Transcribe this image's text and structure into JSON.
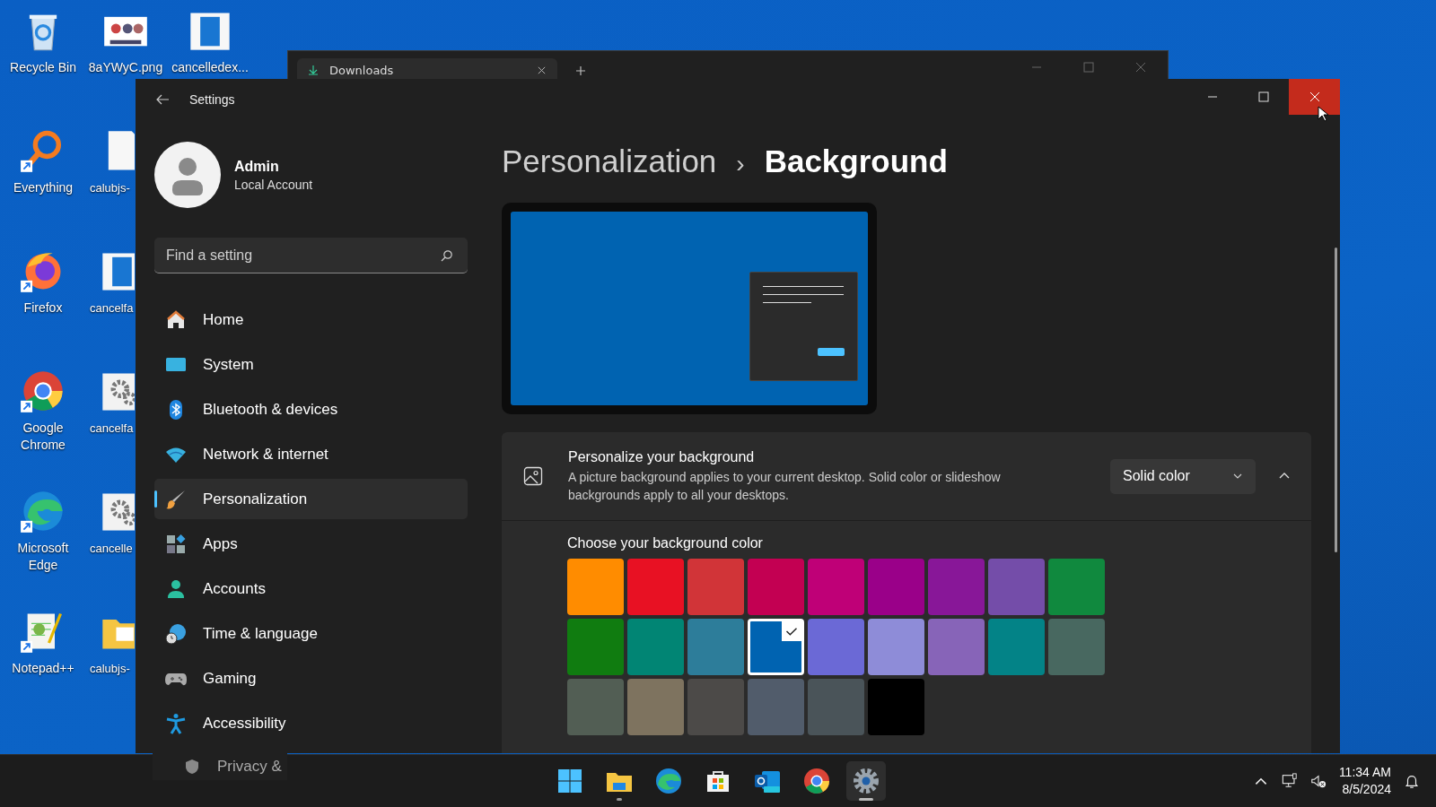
{
  "desktop": {
    "icons": [
      {
        "label": "Recycle Bin",
        "kind": "recycle",
        "shortcut": false
      },
      {
        "label": "Everything",
        "kind": "magnifier",
        "shortcut": true
      },
      {
        "label": "Firefox",
        "kind": "firefox",
        "shortcut": true
      },
      {
        "label": "Google Chrome",
        "kind": "chrome",
        "shortcut": true
      },
      {
        "label": "Microsoft Edge",
        "kind": "edge",
        "shortcut": true
      },
      {
        "label": "Notepad++",
        "kind": "notepad",
        "shortcut": true
      },
      {
        "label": "8aYWyC.png",
        "kind": "image",
        "shortcut": false
      },
      {
        "label": "calubjs-",
        "kind": "page",
        "shortcut": false
      },
      {
        "label": "cancelfa",
        "kind": "doc",
        "shortcut": false
      },
      {
        "label": "cancelfa",
        "kind": "gear",
        "shortcut": false
      },
      {
        "label": "cancelle",
        "kind": "gear",
        "shortcut": false
      },
      {
        "label": "calubjs-",
        "kind": "folder",
        "shortcut": false
      },
      {
        "label": "cancelledex...",
        "kind": "doc",
        "shortcut": false
      }
    ]
  },
  "background_window": {
    "tab": {
      "title": "Downloads"
    }
  },
  "settings": {
    "title": "Settings",
    "user": {
      "name": "Admin",
      "account": "Local Account"
    },
    "search": {
      "placeholder": "Find a setting"
    },
    "nav": [
      {
        "label": "Home",
        "kind": "home",
        "selected": false
      },
      {
        "label": "System",
        "kind": "system",
        "selected": false
      },
      {
        "label": "Bluetooth & devices",
        "kind": "bluetooth",
        "selected": false
      },
      {
        "label": "Network & internet",
        "kind": "network",
        "selected": false
      },
      {
        "label": "Personalization",
        "kind": "brush",
        "selected": true
      },
      {
        "label": "Apps",
        "kind": "apps",
        "selected": false
      },
      {
        "label": "Accounts",
        "kind": "accounts",
        "selected": false
      },
      {
        "label": "Time & language",
        "kind": "time",
        "selected": false
      },
      {
        "label": "Gaming",
        "kind": "gaming",
        "selected": false
      },
      {
        "label": "Accessibility",
        "kind": "accessibility",
        "selected": false
      }
    ],
    "breadcrumb": {
      "parent": "Personalization",
      "separator": "›",
      "current": "Background"
    },
    "background_card": {
      "title": "Personalize your background",
      "description": "A picture background applies to your current desktop. Solid color or slideshow backgrounds apply to all your desktops.",
      "dropdown": "Solid color",
      "expanded": true
    },
    "colors": {
      "label": "Choose your background color",
      "swatches": [
        {
          "color": "#ff8c00",
          "selected": false
        },
        {
          "color": "#e81123",
          "selected": false
        },
        {
          "color": "#d13438",
          "selected": false
        },
        {
          "color": "#c30052",
          "selected": false
        },
        {
          "color": "#bf0077",
          "selected": false
        },
        {
          "color": "#9a0089",
          "selected": false
        },
        {
          "color": "#881798",
          "selected": false
        },
        {
          "color": "#744da9",
          "selected": false
        },
        {
          "color": "#10893e",
          "selected": false
        },
        {
          "color": "#107c10",
          "selected": false
        },
        {
          "color": "#018574",
          "selected": false
        },
        {
          "color": "#2d7d9a",
          "selected": false
        },
        {
          "color": "#0063b1",
          "selected": true
        },
        {
          "color": "#6b69d6",
          "selected": false
        },
        {
          "color": "#8e8cd8",
          "selected": false
        },
        {
          "color": "#8764b8",
          "selected": false
        },
        {
          "color": "#038387",
          "selected": false
        },
        {
          "color": "#486860",
          "selected": false
        },
        {
          "color": "#525e54",
          "selected": false
        },
        {
          "color": "#7e735f",
          "selected": false
        },
        {
          "color": "#4c4a48",
          "selected": false
        },
        {
          "color": "#515c6b",
          "selected": false
        },
        {
          "color": "#4a5459",
          "selected": false
        },
        {
          "color": "#000000",
          "selected": false
        }
      ]
    }
  },
  "overflow_item": {
    "label": "Privacy &"
  },
  "taskbar": {
    "apps": [
      {
        "kind": "start",
        "running": false,
        "active": false
      },
      {
        "kind": "explorer",
        "running": true,
        "active": false
      },
      {
        "kind": "edge",
        "running": false,
        "active": false
      },
      {
        "kind": "store",
        "running": false,
        "active": false
      },
      {
        "kind": "outlook",
        "running": false,
        "active": false
      },
      {
        "kind": "chrome",
        "running": false,
        "active": false
      },
      {
        "kind": "settings",
        "running": true,
        "active": true
      }
    ],
    "time": "11:34 AM",
    "date": "8/5/2024"
  }
}
